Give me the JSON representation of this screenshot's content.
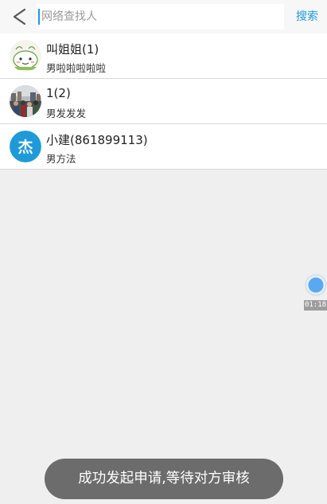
{
  "search": {
    "placeholder": "网络查找人",
    "action_label": "搜索"
  },
  "results": [
    {
      "name": "叫姐姐(1)",
      "subtitle": "男啦啦啦啦啦",
      "avatar": "cartoon-face"
    },
    {
      "name": "1(2)",
      "subtitle": "男发发发",
      "avatar": "crowd-photo"
    },
    {
      "name": "小建(861899113)",
      "subtitle": "男方法",
      "avatar": "letter",
      "avatar_text": "杰",
      "avatar_color": "#1e9ad8"
    }
  ],
  "floating_widget": {
    "time": "01:18",
    "color": "#5aa9f0"
  },
  "toast": {
    "message": "成功发起申请,等待对方审核"
  },
  "colors": {
    "accent": "#1e9ad8",
    "background": "#efefef"
  }
}
